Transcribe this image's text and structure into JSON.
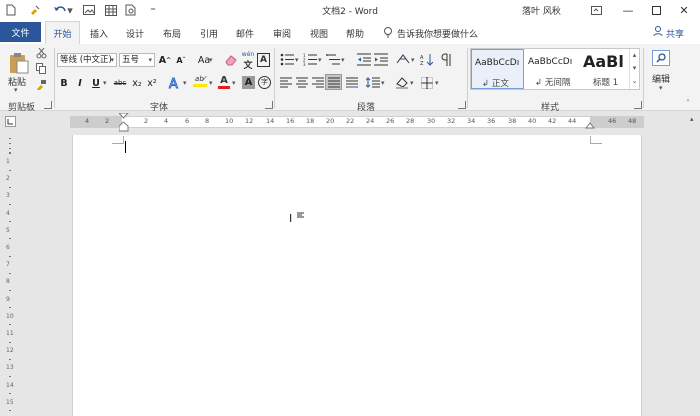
{
  "titlebar": {
    "title": "文档2 - Word",
    "user": "落叶 风秋",
    "quick_access": [
      "new-doc-icon",
      "format-painter-icon",
      "undo-icon",
      "picture-icon",
      "table-icon",
      "print-preview-icon",
      "customize-qat-icon"
    ]
  },
  "tabs": {
    "file": "文件",
    "home": "开始",
    "items": [
      "插入",
      "设计",
      "布局",
      "引用",
      "邮件",
      "审阅",
      "视图",
      "帮助"
    ],
    "tell_me": "告诉我你想要做什么",
    "share": "共享"
  },
  "ribbon": {
    "clipboard": {
      "paste": "粘贴",
      "label": "剪贴板"
    },
    "font": {
      "font_name": "等线 (中文正)",
      "font_size": "五号",
      "label": "字体",
      "grow": "A",
      "shrink": "A",
      "change_case": "Aa",
      "phonetic": "wén",
      "bold": "B",
      "italic": "I",
      "underline": "U",
      "strike": "abc",
      "subscript": "x₂",
      "superscript": "x²",
      "char_shading": "A",
      "font_color": "A"
    },
    "paragraph": {
      "label": "段落"
    },
    "styles": {
      "label": "样式",
      "items": [
        {
          "preview": "AaBbCcDı",
          "name": "↲ 正文"
        },
        {
          "preview": "AaBbCcDı",
          "name": "↲ 无间隔"
        },
        {
          "preview": "AaBl",
          "name": "标题 1"
        }
      ]
    },
    "editing": {
      "label": "编辑"
    }
  },
  "ruler": {
    "ticks": [
      "4",
      "2",
      "2",
      "4",
      "6",
      "8",
      "10",
      "12",
      "14",
      "16",
      "18",
      "20",
      "22",
      "24",
      "26",
      "28",
      "30",
      "32",
      "34",
      "36",
      "38",
      "40",
      "42",
      "44",
      "46",
      "48",
      "50"
    ]
  },
  "vruler": {
    "ticks": [
      "1",
      "2",
      "3",
      "4",
      "5",
      "6",
      "7",
      "8",
      "9",
      "10",
      "11",
      "12",
      "13",
      "14",
      "15",
      "16"
    ]
  },
  "colors": {
    "accent": "#2b579a",
    "highlight_yellow": "#ffe800",
    "font_red": "#e02020"
  }
}
